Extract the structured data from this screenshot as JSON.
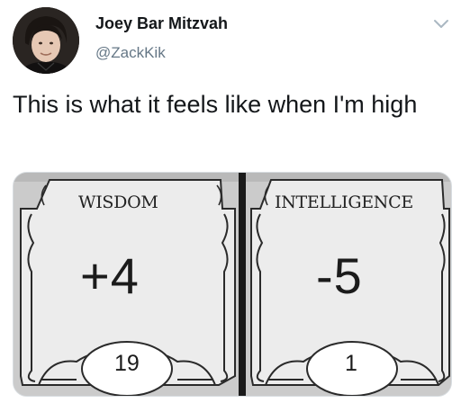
{
  "tweet": {
    "author_name": "Joey Bar Mitzvah",
    "author_handle": "@ZackKik",
    "text": "This is what it feels like when I'm high"
  },
  "icons": {
    "avatar": "profile-photo",
    "menu": "chevron-down-icon"
  },
  "colors": {
    "text": "#14171a",
    "secondary_text": "#657786",
    "card_background": "#ececec",
    "media_background": "#cdcdcd"
  },
  "media": {
    "cards": [
      {
        "label": "WISDOM",
        "value": "+4",
        "score": "19"
      },
      {
        "label": "INTELLIGENCE",
        "value": "-5",
        "score": "1"
      }
    ]
  }
}
